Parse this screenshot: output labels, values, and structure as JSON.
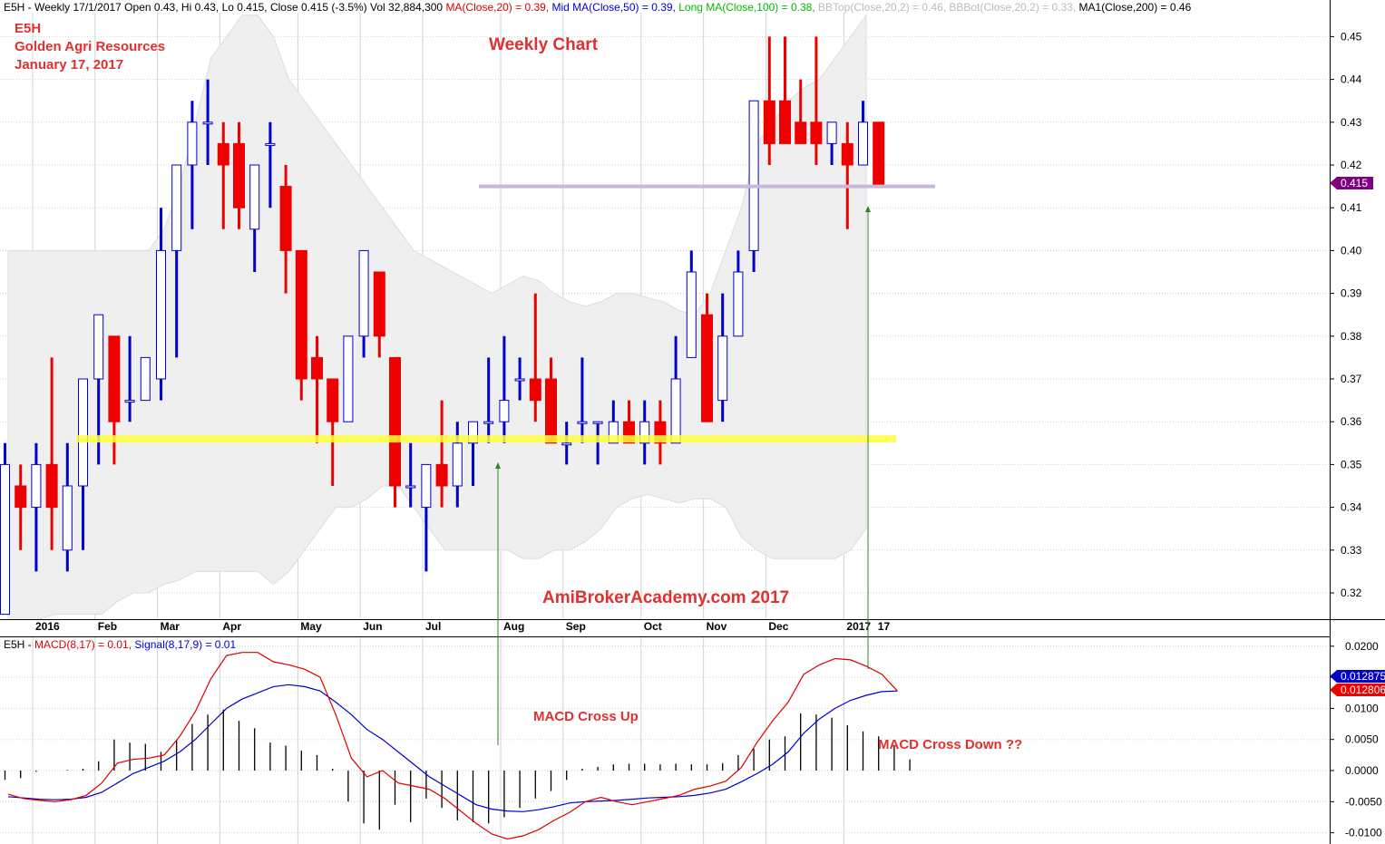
{
  "header": {
    "segments": [
      {
        "text": "E5H - Weekly 17/1/2017 Open 0.43, Hi 0.43, Lo 0.415, Close 0.415 (-3.5%) Vol 32,884,300 ",
        "color": "#000000"
      },
      {
        "text": "MA(Close,20) = 0.39, ",
        "color": "#dd0000"
      },
      {
        "text": "Mid MA(Close,50) = 0.39, ",
        "color": "#0000dd"
      },
      {
        "text": "Long MA(Close,100) = 0.38, ",
        "color": "#00bb00"
      },
      {
        "text": "BBTop(Close,20,2) = 0.46, ",
        "color": "#bbbbbb"
      },
      {
        "text": "BBBot(Close,20,2) = 0.33, ",
        "color": "#bbbbbb"
      },
      {
        "text": "MA1(Close,200) = 0.46",
        "color": "#000000"
      }
    ]
  },
  "annotations": {
    "ticker": "E5H",
    "company": "Golden Agri Resources",
    "date": "January 17, 2017",
    "title": "Weekly Chart",
    "watermark": "AmiBrokerAcademy.com 2017",
    "macd_cross_up": "MACD Cross Up",
    "macd_cross_down": "MACD Cross Down ??"
  },
  "macd_header": {
    "segments": [
      {
        "text": "E5H - ",
        "color": "#000000"
      },
      {
        "text": "MACD(8,17) = 0.01, ",
        "color": "#dd0000"
      },
      {
        "text": "Signal(8,17,9) = 0.01",
        "color": "#0000dd"
      }
    ]
  },
  "colors": {
    "up": "#ffffff",
    "up_border": "#0000cc",
    "down": "#ee0000",
    "bollinger_fill": "#efefef",
    "support_line": "#ffff40",
    "resistance_line": "#c8b8dc",
    "macd_line": "#dd0000",
    "signal_line": "#0000cc",
    "arrow": "#2a8a2a",
    "annotation_text": "#e03030",
    "price_badge": "#800080",
    "macd_badge": "#0000cc",
    "signal_badge": "#ee0000"
  },
  "chart_data": [
    {
      "type": "candlestick",
      "title": "Weekly Chart",
      "ylim": [
        0.31,
        0.455
      ],
      "y_ticks": [
        "0.32",
        "0.33",
        "0.34",
        "0.35",
        "0.36",
        "0.37",
        "0.38",
        "0.39",
        "0.40",
        "0.41",
        "0.42",
        "0.43",
        "0.44",
        "0.45"
      ],
      "x_labels": [
        {
          "week": 1,
          "label": "2016"
        },
        {
          "week": 5,
          "label": "Feb"
        },
        {
          "week": 9,
          "label": "Mar"
        },
        {
          "week": 13,
          "label": "Apr"
        },
        {
          "week": 18,
          "label": "May"
        },
        {
          "week": 22,
          "label": "Jun"
        },
        {
          "week": 26,
          "label": "Jul"
        },
        {
          "week": 31,
          "label": "Aug"
        },
        {
          "week": 35,
          "label": "Sep"
        },
        {
          "week": 40,
          "label": "Oct"
        },
        {
          "week": 44,
          "label": "Nov"
        },
        {
          "week": 48,
          "label": "Dec"
        },
        {
          "week": 53,
          "label": "2017"
        },
        {
          "week": 55,
          "label": "17"
        }
      ],
      "last_price": "0.415",
      "candles": [
        {
          "o": 0.315,
          "h": 0.355,
          "l": 0.315,
          "c": 0.35
        },
        {
          "o": 0.345,
          "h": 0.35,
          "l": 0.33,
          "c": 0.34
        },
        {
          "o": 0.34,
          "h": 0.355,
          "l": 0.325,
          "c": 0.35
        },
        {
          "o": 0.35,
          "h": 0.375,
          "l": 0.33,
          "c": 0.34
        },
        {
          "o": 0.33,
          "h": 0.355,
          "l": 0.325,
          "c": 0.345
        },
        {
          "o": 0.345,
          "h": 0.37,
          "l": 0.33,
          "c": 0.37
        },
        {
          "o": 0.37,
          "h": 0.385,
          "l": 0.35,
          "c": 0.385
        },
        {
          "o": 0.38,
          "h": 0.38,
          "l": 0.35,
          "c": 0.36
        },
        {
          "o": 0.365,
          "h": 0.38,
          "l": 0.36,
          "c": 0.365
        },
        {
          "o": 0.365,
          "h": 0.375,
          "l": 0.365,
          "c": 0.375
        },
        {
          "o": 0.37,
          "h": 0.41,
          "l": 0.365,
          "c": 0.4
        },
        {
          "o": 0.4,
          "h": 0.42,
          "l": 0.375,
          "c": 0.42
        },
        {
          "o": 0.42,
          "h": 0.435,
          "l": 0.405,
          "c": 0.43
        },
        {
          "o": 0.43,
          "h": 0.44,
          "l": 0.42,
          "c": 0.43
        },
        {
          "o": 0.425,
          "h": 0.43,
          "l": 0.405,
          "c": 0.42
        },
        {
          "o": 0.425,
          "h": 0.43,
          "l": 0.405,
          "c": 0.41
        },
        {
          "o": 0.405,
          "h": 0.42,
          "l": 0.395,
          "c": 0.42
        },
        {
          "o": 0.425,
          "h": 0.43,
          "l": 0.41,
          "c": 0.425
        },
        {
          "o": 0.415,
          "h": 0.42,
          "l": 0.39,
          "c": 0.4
        },
        {
          "o": 0.4,
          "h": 0.4,
          "l": 0.365,
          "c": 0.37
        },
        {
          "o": 0.375,
          "h": 0.38,
          "l": 0.355,
          "c": 0.37
        },
        {
          "o": 0.37,
          "h": 0.37,
          "l": 0.345,
          "c": 0.36
        },
        {
          "o": 0.36,
          "h": 0.38,
          "l": 0.36,
          "c": 0.38
        },
        {
          "o": 0.38,
          "h": 0.4,
          "l": 0.375,
          "c": 0.4
        },
        {
          "o": 0.395,
          "h": 0.395,
          "l": 0.375,
          "c": 0.38
        },
        {
          "o": 0.375,
          "h": 0.375,
          "l": 0.34,
          "c": 0.345
        },
        {
          "o": 0.345,
          "h": 0.355,
          "l": 0.34,
          "c": 0.345
        },
        {
          "o": 0.34,
          "h": 0.35,
          "l": 0.325,
          "c": 0.35
        },
        {
          "o": 0.35,
          "h": 0.365,
          "l": 0.34,
          "c": 0.345
        },
        {
          "o": 0.345,
          "h": 0.36,
          "l": 0.34,
          "c": 0.355
        },
        {
          "o": 0.355,
          "h": 0.36,
          "l": 0.345,
          "c": 0.36
        },
        {
          "o": 0.36,
          "h": 0.375,
          "l": 0.355,
          "c": 0.36
        },
        {
          "o": 0.36,
          "h": 0.38,
          "l": 0.355,
          "c": 0.365
        },
        {
          "o": 0.37,
          "h": 0.375,
          "l": 0.365,
          "c": 0.37
        },
        {
          "o": 0.37,
          "h": 0.39,
          "l": 0.36,
          "c": 0.365
        },
        {
          "o": 0.37,
          "h": 0.375,
          "l": 0.355,
          "c": 0.355
        },
        {
          "o": 0.355,
          "h": 0.36,
          "l": 0.35,
          "c": 0.355
        },
        {
          "o": 0.36,
          "h": 0.375,
          "l": 0.355,
          "c": 0.36
        },
        {
          "o": 0.36,
          "h": 0.36,
          "l": 0.35,
          "c": 0.36
        },
        {
          "o": 0.355,
          "h": 0.365,
          "l": 0.355,
          "c": 0.36
        },
        {
          "o": 0.36,
          "h": 0.365,
          "l": 0.355,
          "c": 0.355
        },
        {
          "o": 0.355,
          "h": 0.365,
          "l": 0.35,
          "c": 0.36
        },
        {
          "o": 0.36,
          "h": 0.365,
          "l": 0.35,
          "c": 0.355
        },
        {
          "o": 0.355,
          "h": 0.38,
          "l": 0.355,
          "c": 0.37
        },
        {
          "o": 0.375,
          "h": 0.4,
          "l": 0.375,
          "c": 0.395
        },
        {
          "o": 0.385,
          "h": 0.39,
          "l": 0.36,
          "c": 0.36
        },
        {
          "o": 0.365,
          "h": 0.39,
          "l": 0.36,
          "c": 0.38
        },
        {
          "o": 0.38,
          "h": 0.4,
          "l": 0.38,
          "c": 0.395
        },
        {
          "o": 0.4,
          "h": 0.435,
          "l": 0.395,
          "c": 0.435
        },
        {
          "o": 0.435,
          "h": 0.45,
          "l": 0.42,
          "c": 0.425
        },
        {
          "o": 0.435,
          "h": 0.45,
          "l": 0.425,
          "c": 0.425
        },
        {
          "o": 0.43,
          "h": 0.44,
          "l": 0.425,
          "c": 0.425
        },
        {
          "o": 0.43,
          "h": 0.45,
          "l": 0.42,
          "c": 0.425
        },
        {
          "o": 0.425,
          "h": 0.43,
          "l": 0.42,
          "c": 0.43
        },
        {
          "o": 0.425,
          "h": 0.43,
          "l": 0.405,
          "c": 0.42
        },
        {
          "o": 0.42,
          "h": 0.435,
          "l": 0.42,
          "c": 0.43
        },
        {
          "o": 0.43,
          "h": 0.43,
          "l": 0.415,
          "c": 0.415
        }
      ],
      "bollinger_top": [
        0.4,
        0.4,
        0.4,
        0.4,
        0.4,
        0.4,
        0.4,
        0.4,
        0.4,
        0.4,
        0.405,
        0.415,
        0.43,
        0.445,
        0.45,
        0.455,
        0.455,
        0.45,
        0.44,
        0.435,
        0.43,
        0.425,
        0.42,
        0.415,
        0.41,
        0.405,
        0.4,
        0.398,
        0.396,
        0.394,
        0.392,
        0.39,
        0.392,
        0.394,
        0.393,
        0.39,
        0.388,
        0.387,
        0.388,
        0.39,
        0.39,
        0.389,
        0.388,
        0.386,
        0.385,
        0.39,
        0.4,
        0.41,
        0.425,
        0.43,
        0.435,
        0.438,
        0.44,
        0.445,
        0.45,
        0.455
      ],
      "bollinger_bottom": [
        0.31,
        0.31,
        0.31,
        0.315,
        0.315,
        0.315,
        0.315,
        0.318,
        0.32,
        0.32,
        0.322,
        0.323,
        0.325,
        0.325,
        0.325,
        0.325,
        0.325,
        0.322,
        0.325,
        0.33,
        0.335,
        0.34,
        0.34,
        0.342,
        0.345,
        0.345,
        0.34,
        0.335,
        0.33,
        0.33,
        0.33,
        0.33,
        0.33,
        0.328,
        0.328,
        0.33,
        0.33,
        0.332,
        0.335,
        0.34,
        0.342,
        0.343,
        0.342,
        0.341,
        0.342,
        0.342,
        0.34,
        0.333,
        0.33,
        0.328,
        0.328,
        0.328,
        0.328,
        0.328,
        0.33,
        0.335
      ],
      "support_level": 0.356,
      "resistance_level": 0.415
    },
    {
      "type": "macd",
      "title": "MACD(8,17), Signal(8,17,9)",
      "ylim": [
        -0.0105,
        0.0215
      ],
      "y_ticks": [
        "0.0200",
        "0.0150",
        "0.0100",
        "0.0050",
        "0.0000",
        "-0.0050",
        "-0.0100"
      ],
      "macd_value": "0.012875",
      "signal_value": "0.012806",
      "macd": [
        -0.0038,
        -0.0045,
        -0.0048,
        -0.005,
        -0.0047,
        -0.004,
        -0.002,
        0.0012,
        0.0018,
        0.002,
        0.0025,
        0.0055,
        0.0095,
        0.0148,
        0.0185,
        0.019,
        0.019,
        0.0175,
        0.017,
        0.0163,
        0.015,
        0.009,
        0.002,
        -0.001,
        0.0,
        -0.002,
        -0.0025,
        -0.003,
        -0.0045,
        -0.0065,
        -0.0085,
        -0.0102,
        -0.011,
        -0.0105,
        -0.0095,
        -0.008,
        -0.0067,
        -0.005,
        -0.0043,
        -0.005,
        -0.0055,
        -0.005,
        -0.0045,
        -0.004,
        -0.003,
        -0.0025,
        -0.0017,
        0.0005,
        0.0045,
        0.008,
        0.011,
        0.0155,
        0.017,
        0.018,
        0.0178,
        0.0168,
        0.0155,
        0.0128
      ],
      "signal": [
        -0.0042,
        -0.0044,
        -0.0046,
        -0.0047,
        -0.0046,
        -0.0043,
        -0.0035,
        -0.002,
        -0.0005,
        0.0005,
        0.0015,
        0.003,
        0.005,
        0.0075,
        0.01,
        0.0115,
        0.0125,
        0.0135,
        0.0138,
        0.0135,
        0.0128,
        0.011,
        0.009,
        0.0066,
        0.005,
        0.003,
        0.001,
        -0.001,
        -0.0025,
        -0.004,
        -0.0055,
        -0.0062,
        -0.0065,
        -0.0066,
        -0.0063,
        -0.0058,
        -0.0052,
        -0.005,
        -0.0049,
        -0.0048,
        -0.0046,
        -0.0044,
        -0.0043,
        -0.0042,
        -0.004,
        -0.0036,
        -0.003,
        -0.0018,
        -0.0005,
        0.001,
        0.003,
        0.006,
        0.0083,
        0.01,
        0.0113,
        0.0121,
        0.0127,
        0.0128
      ],
      "histogram": [
        -0.0015,
        -0.0012,
        -0.0002,
        0.0,
        0.0001,
        0.0003,
        0.0015,
        0.005,
        0.0045,
        0.0043,
        0.003,
        0.005,
        0.0075,
        0.009,
        0.0098,
        0.008,
        0.0068,
        0.0045,
        0.004,
        0.0032,
        0.0025,
        0.0003,
        -0.005,
        -0.0085,
        -0.0095,
        -0.0055,
        -0.0083,
        -0.0045,
        -0.006,
        -0.008,
        -0.0083,
        -0.0085,
        -0.0075,
        -0.006,
        -0.0045,
        -0.0033,
        -0.0015,
        0.0003,
        0.0006,
        0.001,
        0.0011,
        0.0011,
        0.001,
        0.0011,
        0.001,
        0.001,
        0.0012,
        0.0025,
        0.0035,
        0.005,
        0.0055,
        0.0092,
        0.009,
        0.0085,
        0.0073,
        0.0063,
        0.0055,
        0.0041,
        0.0018
      ]
    }
  ]
}
